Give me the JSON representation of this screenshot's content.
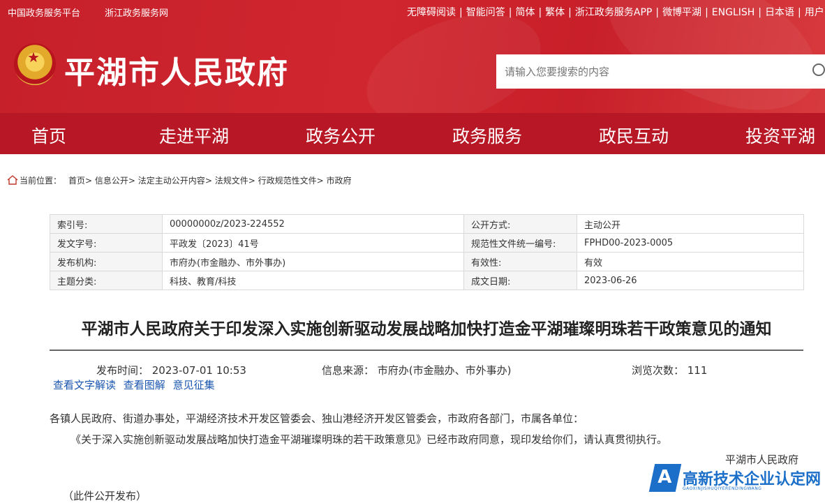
{
  "topbar": {
    "left_links": [
      "中国政务服务平台",
      "浙江政务服务网"
    ],
    "right_links": [
      "无障碍阅读",
      "智能问答",
      "简体",
      "繁体",
      "浙江政务服务APP",
      "微博平湖",
      "ENGLISH",
      "日本语",
      "用户"
    ]
  },
  "header": {
    "site_title": "平湖市人民政府",
    "search_placeholder": "请输入您要搜索的内容"
  },
  "nav": [
    "首页",
    "走进平湖",
    "政务公开",
    "政务服务",
    "政民互动",
    "投资平湖"
  ],
  "breadcrumb": {
    "label": "当前位置：",
    "items": [
      "首页",
      "信息公开",
      "法定主动公开内容",
      "法规文件",
      "行政规范性文件",
      "市政府"
    ]
  },
  "info_table": [
    [
      "索引号:",
      "00000000z/2023-224552",
      "公开方式:",
      "主动公开"
    ],
    [
      "发文字号:",
      "平政发〔2023〕41号",
      "规范性文件统一编号:",
      "FPHD00-2023-0005"
    ],
    [
      "发布机构:",
      "市府办(市金融办、市外事办)",
      "有效性:",
      "有效"
    ],
    [
      "主题分类:",
      "科技、教育/科技",
      "成文日期:",
      "2023-06-26"
    ]
  ],
  "article": {
    "title": "平湖市人民政府关于印发深入实施创新驱动发展战略加快打造金平湖璀璨明珠若干政策意见的通知",
    "publish_time": "发布时间：  2023-07-01 10:53",
    "source": "信息来源：  市府办(市金融办、市外事办)",
    "views": "浏览次数：  111",
    "links": [
      "查看文字解读",
      "查看图解",
      "意见征集"
    ],
    "para1": "各镇人民政府、街道办事处，平湖经济技术开发区管委会、独山港经济开发区管委会，市政府各部门，市属各单位：",
    "para2": "《关于深入实施创新驱动发展战略加快打造金平湖璀璨明珠的若干政策意见》已经市政府同意，现印发给你们，请认真贯彻执行。",
    "signature": "平湖市人民政府",
    "cut_line": "（此件公开发布）"
  },
  "watermark": {
    "logo_letter": "A",
    "text": "高新技术企业认定网",
    "sub": "GAOXINJISHUQIYERENDINGWANG"
  },
  "colors": {
    "header_red": "#c6202b",
    "nav_red": "#b81826",
    "link_blue": "#1a56b0"
  }
}
